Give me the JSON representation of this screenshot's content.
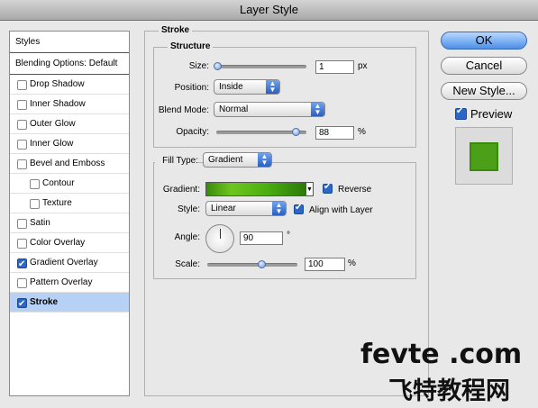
{
  "window": {
    "title": "Layer Style"
  },
  "sidebar": {
    "header": "Styles",
    "blending": "Blending Options: Default",
    "items": [
      {
        "label": "Drop Shadow",
        "checked": false,
        "sub": false
      },
      {
        "label": "Inner Shadow",
        "checked": false,
        "sub": false
      },
      {
        "label": "Outer Glow",
        "checked": false,
        "sub": false
      },
      {
        "label": "Inner Glow",
        "checked": false,
        "sub": false
      },
      {
        "label": "Bevel and Emboss",
        "checked": false,
        "sub": false
      },
      {
        "label": "Contour",
        "checked": false,
        "sub": true
      },
      {
        "label": "Texture",
        "checked": false,
        "sub": true
      },
      {
        "label": "Satin",
        "checked": false,
        "sub": false
      },
      {
        "label": "Color Overlay",
        "checked": false,
        "sub": false
      },
      {
        "label": "Gradient Overlay",
        "checked": true,
        "sub": false
      },
      {
        "label": "Pattern Overlay",
        "checked": false,
        "sub": false
      },
      {
        "label": "Stroke",
        "checked": true,
        "sub": false,
        "selected": true
      }
    ]
  },
  "stroke": {
    "title": "Stroke",
    "structure": {
      "title": "Structure",
      "size_label": "Size:",
      "size_value": "1",
      "size_unit": "px",
      "size_level": 0.01,
      "position_label": "Position:",
      "position_value": "Inside",
      "blend_label": "Blend Mode:",
      "blend_value": "Normal",
      "opacity_label": "Opacity:",
      "opacity_value": "88",
      "opacity_unit": "%",
      "opacity_level": 0.88
    },
    "fill": {
      "type_label": "Fill Type:",
      "type_value": "Gradient",
      "gradient_label": "Gradient:",
      "reverse_label": "Reverse",
      "reverse_checked": true,
      "style_label": "Style:",
      "style_value": "Linear",
      "align_label": "Align with Layer",
      "align_checked": true,
      "angle_label": "Angle:",
      "angle_value": "90",
      "angle_unit": "°",
      "scale_label": "Scale:",
      "scale_value": "100",
      "scale_unit": "%",
      "scale_level": 0.6
    }
  },
  "buttons": {
    "ok": "OK",
    "cancel": "Cancel",
    "new_style": "New Style...",
    "preview": "Preview",
    "preview_checked": true
  },
  "watermark": {
    "line1": "fevte .com",
    "line2": "飞特教程网"
  },
  "colors": {
    "accent": "#2a67c9",
    "stroke_green": "#4ca018"
  }
}
